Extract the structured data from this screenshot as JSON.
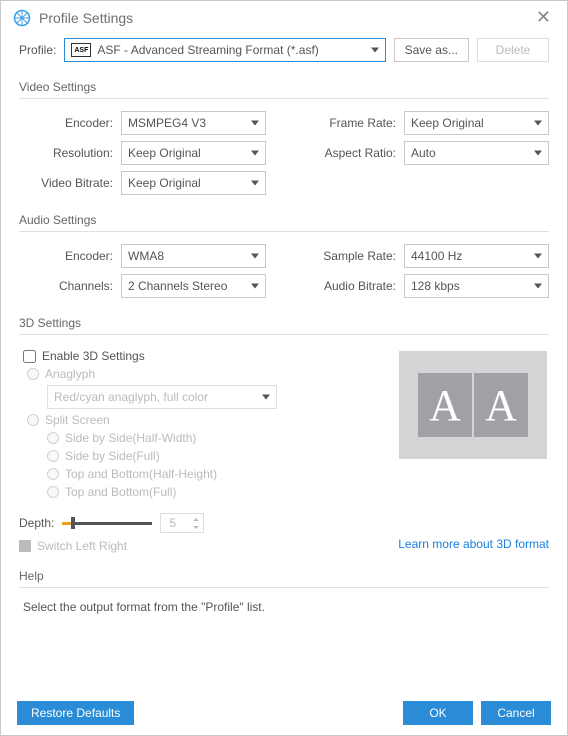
{
  "title": "Profile Settings",
  "profile": {
    "label": "Profile:",
    "icon_text": "ASF",
    "value": "ASF - Advanced Streaming Format (*.asf)",
    "save_as": "Save as...",
    "delete": "Delete"
  },
  "video": {
    "heading": "Video Settings",
    "encoder_label": "Encoder:",
    "encoder": "MSMPEG4 V3",
    "resolution_label": "Resolution:",
    "resolution": "Keep Original",
    "bitrate_label": "Video Bitrate:",
    "bitrate": "Keep Original",
    "framerate_label": "Frame Rate:",
    "framerate": "Keep Original",
    "aspect_label": "Aspect Ratio:",
    "aspect": "Auto"
  },
  "audio": {
    "heading": "Audio Settings",
    "encoder_label": "Encoder:",
    "encoder": "WMA8",
    "channels_label": "Channels:",
    "channels": "2 Channels Stereo",
    "samplerate_label": "Sample Rate:",
    "samplerate": "44100 Hz",
    "bitrate_label": "Audio Bitrate:",
    "bitrate": "128 kbps"
  },
  "threeD": {
    "heading": "3D Settings",
    "enable": "Enable 3D Settings",
    "anaglyph": "Anaglyph",
    "anaglyph_mode": "Red/cyan anaglyph, full color",
    "split": "Split Screen",
    "sbs_half": "Side by Side(Half-Width)",
    "sbs_full": "Side by Side(Full)",
    "tab_half": "Top and Bottom(Half-Height)",
    "tab_full": "Top and Bottom(Full)",
    "depth_label": "Depth:",
    "depth_value": "5",
    "switch_lr": "Switch Left Right",
    "learn_more": "Learn more about 3D format",
    "preview_letter": "A"
  },
  "help": {
    "heading": "Help",
    "text": "Select the output format from the \"Profile\" list."
  },
  "footer": {
    "restore": "Restore Defaults",
    "ok": "OK",
    "cancel": "Cancel"
  }
}
